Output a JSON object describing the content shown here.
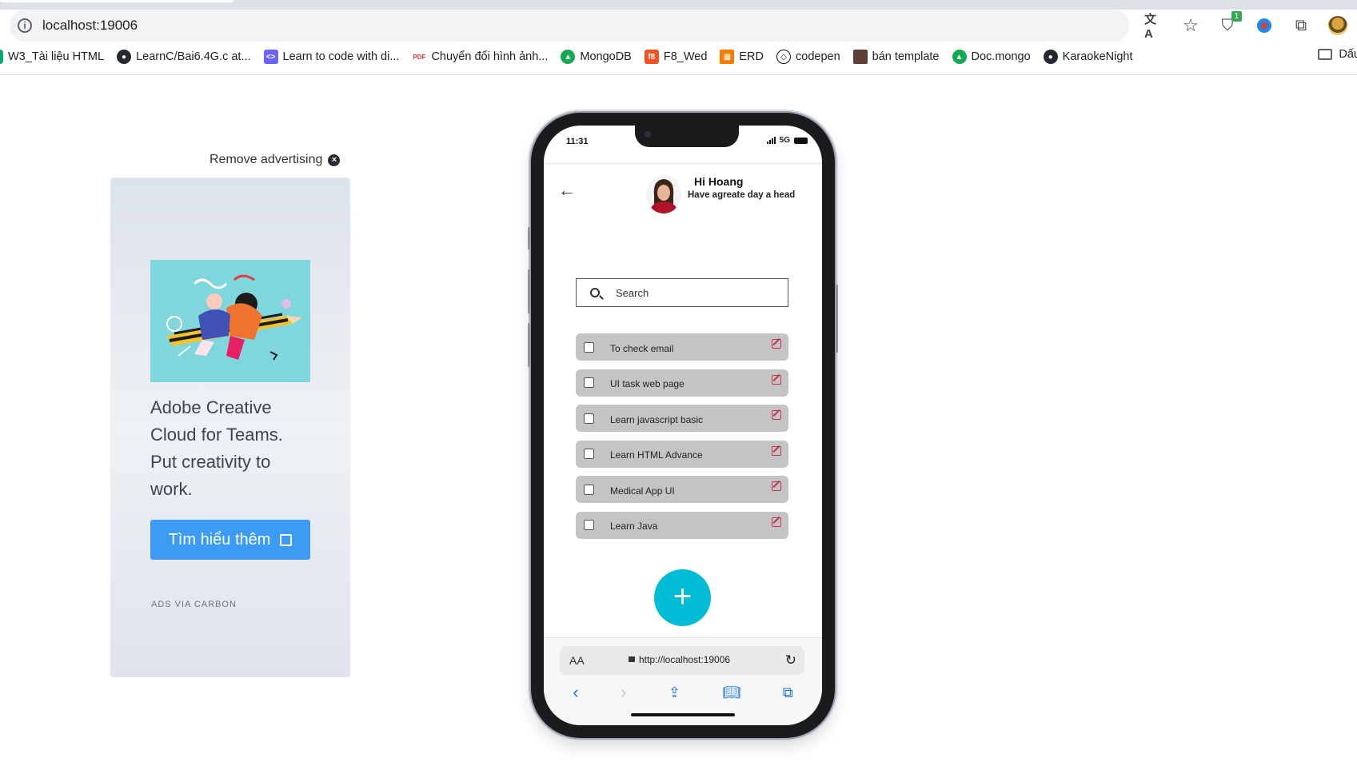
{
  "browser": {
    "url": "localhost:19006",
    "extensions": [
      {
        "name": "translate-icon",
        "glyph": "文A"
      },
      {
        "name": "star-icon",
        "glyph": "☆"
      },
      {
        "name": "shield-extension-icon",
        "glyph": "⛉",
        "badge": "1"
      },
      {
        "name": "extension-colorful-icon",
        "glyph": "⬤"
      },
      {
        "name": "puzzle-icon",
        "glyph": "⧉"
      }
    ],
    "bookmarks": [
      {
        "label": "W3_Tài liệu HTML",
        "icon": "w3-icon",
        "color": "#04aa6d"
      },
      {
        "label": "LearnC/Bai6.4G.c at...",
        "icon": "github-icon",
        "color": "#24292f"
      },
      {
        "label": "Learn to code with di...",
        "icon": "code-icon",
        "color": "#6b63f6"
      },
      {
        "label": "Chuyển đổi hình ảnh...",
        "icon": "pdf24-icon",
        "color": "#e53935"
      },
      {
        "label": "MongoDB",
        "icon": "mongodb-icon",
        "color": "#13aa52"
      },
      {
        "label": "F8_Wed",
        "icon": "f8-icon",
        "color": "#f05123"
      },
      {
        "label": "ERD",
        "icon": "erd-icon",
        "color": "#f57c00"
      },
      {
        "label": "codepen",
        "icon": "codepen-icon",
        "color": "#111111"
      },
      {
        "label": "bán template",
        "icon": "template-icon",
        "color": "#5d4037"
      },
      {
        "label": "Doc.mongo",
        "icon": "mongodb-icon",
        "color": "#13aa52"
      },
      {
        "label": "KaraokeNight",
        "icon": "github-icon",
        "color": "#24292f"
      }
    ],
    "bookmarks_folder": "Dấu"
  },
  "ad": {
    "remove_label": "Remove advertising",
    "headline": "Adobe Creative Cloud for Teams. Put creativity to work.",
    "button_label": "Tìm hiểu thêm",
    "via": "ADS VIA CARBON"
  },
  "phone": {
    "time": "11:31",
    "network": "5G",
    "greeting_name": "Hi Hoang",
    "greeting_sub": "Have agreate day a head",
    "search_placeholder": "Search",
    "tasks": [
      {
        "label": "To check email",
        "checked": false
      },
      {
        "label": "UI task web page",
        "checked": false
      },
      {
        "label": "Learn javascript basic",
        "checked": false
      },
      {
        "label": "Learn HTML Advance",
        "checked": false
      },
      {
        "label": "Medical App UI",
        "checked": false
      },
      {
        "label": "Learn Java",
        "checked": false
      }
    ],
    "fab_label": "+",
    "safari": {
      "aa": "AA",
      "url": "http://localhost:19006"
    },
    "accent_color": "#00bcd4"
  }
}
